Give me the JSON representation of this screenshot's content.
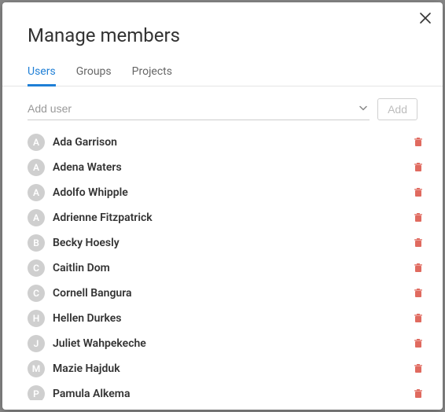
{
  "dialog": {
    "title": "Manage members"
  },
  "tabs": {
    "items": [
      {
        "label": "Users",
        "active": true
      },
      {
        "label": "Groups",
        "active": false
      },
      {
        "label": "Projects",
        "active": false
      }
    ]
  },
  "add": {
    "placeholder": "Add user",
    "button_label": "Add"
  },
  "users": [
    {
      "initial": "A",
      "name": "Ada Garrison"
    },
    {
      "initial": "A",
      "name": "Adena Waters"
    },
    {
      "initial": "A",
      "name": "Adolfo Whipple"
    },
    {
      "initial": "A",
      "name": "Adrienne Fitzpatrick"
    },
    {
      "initial": "B",
      "name": "Becky Hoesly"
    },
    {
      "initial": "C",
      "name": "Caitlin Dom"
    },
    {
      "initial": "C",
      "name": "Cornell Bangura"
    },
    {
      "initial": "H",
      "name": "Hellen Durkes"
    },
    {
      "initial": "J",
      "name": "Juliet Wahpekeche"
    },
    {
      "initial": "M",
      "name": "Mazie Hajduk"
    },
    {
      "initial": "P",
      "name": "Pamula Alkema"
    }
  ]
}
